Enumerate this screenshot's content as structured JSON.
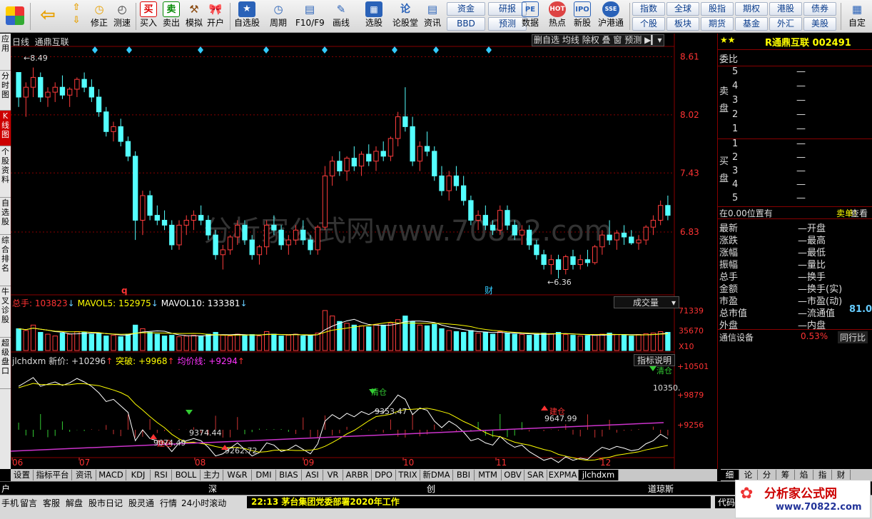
{
  "toolbar": {
    "buttons": [
      "修正",
      "测速",
      "买入",
      "卖出",
      "模拟",
      "开户",
      "自选股",
      "周期",
      "F10/F9",
      "画线",
      "选股",
      "论股堂",
      "资讯",
      "数据",
      "热点",
      "新股",
      "沪港通",
      "自定"
    ],
    "small_buttons": [
      "资金",
      "研报",
      "BBD",
      "预测",
      "指数",
      "全球",
      "股指",
      "期权",
      "港股",
      "债券",
      "个股",
      "板块",
      "期货",
      "基金",
      "外汇",
      "美股"
    ]
  },
  "left_tabs": [
    "应用",
    "分时图",
    "K线图",
    "个股资料",
    "自选股",
    "综合排名",
    "牛叉诊股",
    "超级盘口"
  ],
  "chart": {
    "period": "日线",
    "stock_name": "通鼎互联",
    "toolbar_items": [
      "删自选",
      "均线",
      "除权",
      "叠",
      "窗",
      "预测"
    ],
    "price_ticks": [
      "8.61",
      "8.02",
      "7.43",
      "6.83"
    ],
    "high_label": "8.49",
    "low_label": "6.36",
    "markers": {
      "q": "q",
      "cai": "财"
    },
    "watermark": "分析家公式网www.70822.com",
    "volume": {
      "label_total": "总手: 103823",
      "label_ma5": "MAVOL5: 152975",
      "label_ma10": "MAVOL10: 133381",
      "dropdown": "成交量",
      "ticks": [
        "71339",
        "35670",
        "X10"
      ]
    },
    "indicator": {
      "name": "jlchdxm",
      "new_price": "新价: +10296",
      "breakout": "突破: +9968",
      "avg_line": "均价线: +9294",
      "explain_btn": "指标说明",
      "ticks": [
        "+10501",
        "+9879",
        "+9256"
      ],
      "annotations": [
        "建仓",
        "9374.44",
        "清仓",
        "9353.47",
        "9647.99",
        "建仓",
        "清仓",
        "10350.",
        "9074.49",
        "9262.72"
      ]
    },
    "months": [
      "06",
      "07",
      "08",
      "09",
      "10",
      "11",
      "12"
    ]
  },
  "chart_data": {
    "type": "candlestick",
    "title": "通鼎互联",
    "ylim": [
      6.2,
      8.7
    ],
    "candles": [
      [
        8.45,
        8.45,
        8.1,
        8.2
      ],
      [
        8.2,
        8.35,
        8.0,
        8.3
      ],
      [
        8.3,
        8.5,
        8.2,
        8.4
      ],
      [
        8.4,
        8.45,
        8.15,
        8.2
      ],
      [
        8.2,
        8.3,
        8.1,
        8.25
      ],
      [
        8.25,
        8.35,
        8.15,
        8.3
      ],
      [
        8.3,
        8.42,
        8.18,
        8.22
      ],
      [
        8.22,
        8.3,
        8.1,
        8.28
      ],
      [
        8.28,
        8.4,
        8.2,
        8.38
      ],
      [
        8.38,
        8.45,
        8.25,
        8.3
      ],
      [
        8.3,
        8.38,
        8.15,
        8.2
      ],
      [
        8.2,
        8.28,
        8.0,
        8.05
      ],
      [
        8.05,
        8.1,
        7.8,
        7.85
      ],
      [
        7.85,
        7.95,
        7.75,
        7.9
      ],
      [
        7.9,
        7.98,
        7.7,
        7.75
      ],
      [
        7.75,
        7.8,
        7.55,
        7.6
      ],
      [
        7.6,
        7.65,
        6.75,
        6.95
      ],
      [
        6.95,
        7.25,
        6.8,
        7.2
      ],
      [
        7.2,
        7.25,
        6.95,
        7.0
      ],
      [
        7.0,
        7.1,
        6.9,
        6.95
      ],
      [
        6.95,
        7.05,
        6.85,
        6.9
      ],
      [
        6.9,
        6.95,
        6.65,
        6.7
      ],
      [
        6.7,
        6.95,
        6.65,
        6.9
      ],
      [
        6.9,
        7.0,
        6.8,
        6.95
      ],
      [
        6.95,
        7.05,
        6.85,
        7.0
      ],
      [
        7.0,
        7.1,
        6.9,
        6.95
      ],
      [
        6.95,
        7.0,
        6.75,
        6.8
      ],
      [
        6.8,
        6.85,
        6.55,
        6.6
      ],
      [
        6.6,
        6.7,
        6.45,
        6.65
      ],
      [
        6.65,
        6.8,
        6.6,
        6.78
      ],
      [
        6.78,
        6.95,
        6.7,
        6.9
      ],
      [
        6.9,
        6.95,
        6.7,
        6.75
      ],
      [
        6.75,
        6.8,
        6.55,
        6.6
      ],
      [
        6.6,
        6.7,
        6.5,
        6.68
      ],
      [
        6.68,
        6.95,
        6.6,
        6.9
      ],
      [
        6.9,
        7.0,
        6.8,
        6.85
      ],
      [
        6.85,
        6.9,
        6.65,
        6.7
      ],
      [
        6.7,
        6.8,
        6.6,
        6.75
      ],
      [
        6.75,
        6.9,
        6.7,
        6.85
      ],
      [
        6.85,
        6.95,
        6.7,
        6.75
      ],
      [
        6.75,
        6.8,
        6.6,
        6.65
      ],
      [
        6.65,
        6.9,
        6.6,
        6.88
      ],
      [
        6.88,
        7.5,
        6.85,
        7.4
      ],
      [
        7.4,
        7.6,
        7.3,
        7.55
      ],
      [
        7.55,
        7.65,
        7.4,
        7.45
      ],
      [
        7.45,
        7.6,
        7.35,
        7.58
      ],
      [
        7.58,
        7.7,
        7.45,
        7.5
      ],
      [
        7.5,
        7.65,
        7.4,
        7.62
      ],
      [
        7.62,
        7.72,
        7.5,
        7.55
      ],
      [
        7.55,
        7.7,
        7.45,
        7.65
      ],
      [
        7.65,
        7.75,
        7.55,
        7.6
      ],
      [
        7.6,
        7.8,
        7.55,
        7.78
      ],
      [
        7.78,
        8.05,
        7.7,
        8.0
      ],
      [
        8.0,
        8.3,
        7.85,
        7.9
      ],
      [
        7.9,
        8.0,
        7.5,
        7.55
      ],
      [
        7.55,
        7.75,
        7.45,
        7.7
      ],
      [
        7.7,
        7.85,
        7.6,
        7.65
      ],
      [
        7.65,
        7.7,
        7.35,
        7.4
      ],
      [
        7.4,
        7.5,
        7.2,
        7.25
      ],
      [
        7.25,
        7.45,
        7.15,
        7.4
      ],
      [
        7.4,
        7.5,
        7.25,
        7.3
      ],
      [
        7.3,
        7.4,
        7.1,
        7.15
      ],
      [
        7.15,
        7.2,
        6.9,
        6.95
      ],
      [
        6.95,
        7.05,
        6.85,
        7.0
      ],
      [
        7.0,
        7.1,
        6.85,
        6.9
      ],
      [
        6.9,
        6.95,
        6.8,
        6.85
      ],
      [
        6.85,
        7.1,
        6.8,
        7.05
      ],
      [
        7.05,
        7.1,
        6.85,
        6.9
      ],
      [
        6.9,
        6.95,
        6.75,
        6.8
      ],
      [
        6.8,
        6.9,
        6.7,
        6.85
      ],
      [
        6.85,
        6.9,
        6.65,
        6.7
      ],
      [
        6.7,
        6.75,
        6.55,
        6.6
      ],
      [
        6.6,
        6.65,
        6.45,
        6.5
      ],
      [
        6.5,
        6.6,
        6.4,
        6.55
      ],
      [
        6.55,
        6.6,
        6.36,
        6.45
      ],
      [
        6.45,
        6.6,
        6.4,
        6.58
      ],
      [
        6.58,
        6.65,
        6.45,
        6.5
      ],
      [
        6.5,
        6.6,
        6.45,
        6.55
      ],
      [
        6.55,
        6.65,
        6.48,
        6.52
      ],
      [
        6.52,
        6.7,
        6.5,
        6.68
      ],
      [
        6.68,
        6.85,
        6.6,
        6.8
      ],
      [
        6.8,
        6.95,
        6.7,
        6.75
      ],
      [
        6.75,
        6.85,
        6.65,
        6.82
      ],
      [
        6.82,
        6.9,
        6.7,
        6.78
      ],
      [
        6.78,
        6.85,
        6.7,
        6.72
      ],
      [
        6.72,
        6.8,
        6.65,
        6.75
      ],
      [
        6.75,
        6.9,
        6.7,
        6.88
      ],
      [
        6.88,
        7.0,
        6.8,
        6.95
      ],
      [
        6.95,
        7.15,
        6.9,
        7.1
      ],
      [
        7.1,
        7.2,
        6.95,
        7.0
      ]
    ],
    "volume": [
      60,
      55,
      70,
      50,
      45,
      40,
      48,
      45,
      52,
      50,
      45,
      48,
      40,
      42,
      38,
      45,
      70,
      60,
      50,
      45,
      40,
      42,
      38,
      40,
      42,
      40,
      45,
      50,
      42,
      40,
      45,
      42,
      44,
      40,
      52,
      45,
      40,
      42,
      45,
      40,
      42,
      48,
      110,
      95,
      80,
      75,
      70,
      68,
      65,
      72,
      70,
      75,
      85,
      95,
      80,
      70,
      68,
      72,
      60,
      55,
      52,
      50,
      55,
      48,
      50,
      45,
      52,
      48,
      45,
      44,
      42,
      45,
      48,
      46,
      50,
      44,
      42,
      40,
      41,
      42,
      45,
      48,
      44,
      42,
      40,
      44,
      46,
      48,
      52,
      50
    ]
  },
  "right_panel": {
    "title": "R通鼎互联 002491",
    "stars": "★★",
    "weibi": "委比",
    "sell_label": "卖盘",
    "buy_label": "买盘",
    "sell_levels": [
      "5",
      "4",
      "3",
      "2",
      "1"
    ],
    "buy_levels": [
      "1",
      "2",
      "3",
      "4",
      "5"
    ],
    "dash": "—",
    "position_text": "在0.00位置有",
    "sell_order": "卖单!",
    "check": "查看",
    "stats_left": [
      "最新",
      "涨跌",
      "涨幅",
      "振幅",
      "总手",
      "金额",
      "市盈",
      "总市值",
      "外盘"
    ],
    "stats_right": [
      "开盘",
      "最高",
      "最低",
      "量比",
      "换手",
      "换手(实)",
      "市盈(动)",
      "流通值",
      "内盘"
    ],
    "float_value": "81.0",
    "telecom": "通信设备",
    "telecom_pct": "0.53%",
    "same_industry": "同行比"
  },
  "bottom_tabs": [
    "设置",
    "指标平台",
    "资讯",
    "MACD",
    "KDJ",
    "RSI",
    "BOLL",
    "主力",
    "W&R",
    "DMI",
    "BIAS",
    "ASI",
    "VR",
    "ARBR",
    "DPO",
    "TRIX",
    "新DMA",
    "BBI",
    "MTM",
    "OBV",
    "SAR",
    "EXPMA",
    "jlchdxm"
  ],
  "right_mini_tabs": [
    "细",
    "论",
    "分",
    "筹",
    "焰",
    "指",
    "财"
  ],
  "index_strip": [
    "户",
    "深",
    "创",
    "道琼斯"
  ],
  "status_bar": {
    "items": [
      "手机",
      "留言",
      "客服",
      "解盘",
      "股市日记",
      "股灵通",
      "行情",
      "24小时滚动"
    ],
    "news": "22:13 茅台集团党委部署2020年工作",
    "logo": "分析家公式网",
    "logo_url": "www.70822.com",
    "code_label": "代码"
  }
}
